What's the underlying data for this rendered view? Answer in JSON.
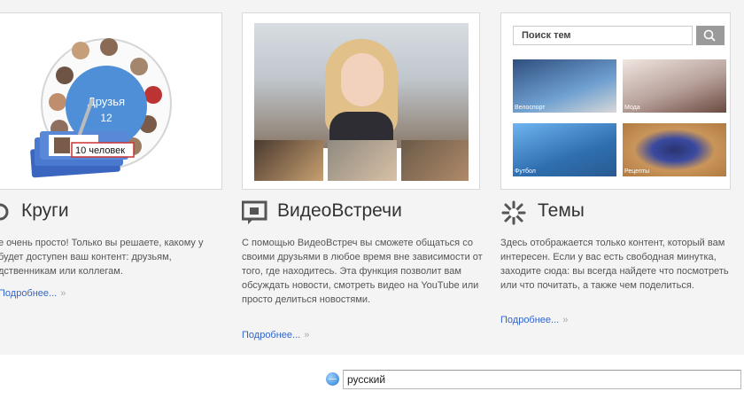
{
  "circles": {
    "title": "Круги",
    "badge_name": "Друзья",
    "badge_count": "12",
    "tag_label": "10 человек",
    "description": "е очень просто! Только вы решаете, какому у будет доступен ваш контент: друзьям, дственникам или коллегам.",
    "more": "Подробнее...",
    "chevron": "»"
  },
  "hangouts": {
    "title": "ВидеоВстречи",
    "description": "С помощью ВидеоВстреч вы сможете общаться со своими друзьями в любое время вне зависимости от того, где находитесь. Эта функция позволит вам обсуждать новости, смотреть видео на YouTube или просто делиться новостями.",
    "more": "Подробнее...",
    "chevron": "»"
  },
  "topics": {
    "title": "Темы",
    "search_placeholder": "Поиск тем",
    "tiles": [
      "Велоспорт",
      "Мода",
      "Футбол",
      "Рецепты"
    ],
    "description": "Здесь отображается только контент, который вам интересен. Если у вас есть свободная минутка, заходите сюда: вы всегда найдете что посмотреть или что почитать, а также чем поделиться.",
    "more": "Подробнее...",
    "chevron": "»"
  },
  "language": {
    "selected": "русский"
  },
  "colors": {
    "link": "#3366cc",
    "circle_blue": "#4a90d9",
    "tag_red": "#cc3333"
  }
}
